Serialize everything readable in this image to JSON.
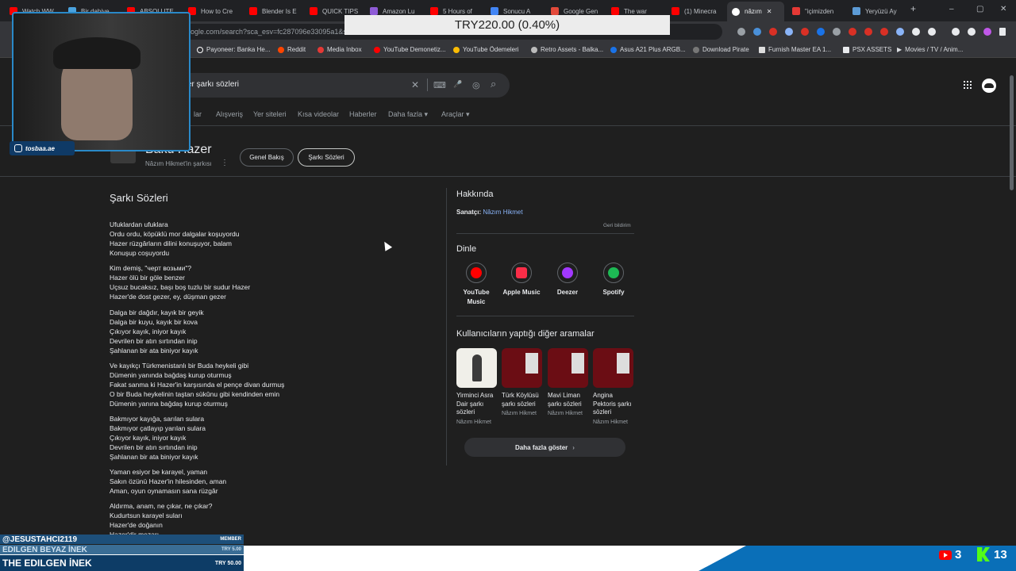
{
  "browser": {
    "tabs": [
      "Watch WW",
      "Bir dahiye",
      "ABSOLUTE",
      "How to Cre",
      "Blender Is E",
      "QUICK TIPS",
      "Amazon Lu",
      "5 Hours of",
      "Sonucu A",
      "Google Gen",
      "The war",
      "(1) Minecra",
      "nâzım",
      "\"içimizden",
      "Yeryüzü Ay"
    ],
    "new_tab": "+",
    "minimize": "–",
    "maximize": "▢",
    "close": "✕",
    "url": "ogle.com/search?sca_esv=fc287096e33095a1&s"
  },
  "bookmarks": [
    "Payoneer: Banka He...",
    "Reddit",
    "Media Inbox",
    "YouTube Demonetiz...",
    "YouTube Ödemeleri",
    "Retro Assets - Balka...",
    "Asus A21 Plus ARGB...",
    "Download Pirate",
    "Furnish Master EA 1...",
    "PSX ASSETS",
    "Movies / TV / Anim..."
  ],
  "search": {
    "query": "er şarkı sözleri",
    "clear_icon": "✕",
    "keyboard_icon": "⌨",
    "mic_icon": "🎤",
    "lens_icon": "◎",
    "search_icon": "⌕"
  },
  "nav_tabs": [
    "lar",
    "Alışveriş",
    "Yer siteleri",
    "Kısa videolar",
    "Haberler",
    "Daha fazla ▾",
    "Araçlar ▾"
  ],
  "entity": {
    "title": "Bakü Hazer",
    "subtitle": "Nâzım Hikmet'in şarkısı",
    "chips": [
      "Genel Bakış",
      "Şarkı Sözleri"
    ]
  },
  "lyrics": {
    "heading": "Şarkı Sözleri",
    "stanzas": [
      [
        "Ufuklardan ufuklara",
        "Ordu ordu, köpüklü mor dalgalar koşuyordu",
        "Hazer rüzgârların dilini konuşuyor, balam",
        "Konuşup coşuyordu"
      ],
      [
        "Kim demiş, \"черт возьми\"?",
        "Hazer ölü bir göle benzer",
        "Uçsuz bucaksız, başı boş tuzlu bir sudur Hazer",
        "Hazer'de dost gezer, ey, düşman gezer"
      ],
      [
        "Dalga bir dağdır, kayık bir geyik",
        "Dalga bir kuyu, kayık bir kova",
        "Çıkıyor kayık, iniyor kayık",
        "Devrilen bir atın sırtından inip",
        "Şahlanan bir ata biniyor kayık"
      ],
      [
        "Ve kayıkçı Türkmenistanlı bir Buda heykeli gibi",
        "Dümenin yanında bağdaş kurup oturmuş",
        "Fakat sanma ki Hazer'in karşısında el pençe divan durmuş",
        "O bir Buda heykelinin taştan sükûnu gibi kendinden emin",
        "Dümenin yanına bağdaş kurup oturmuş"
      ],
      [
        "Bakmıyor kayığa, sarılan sulara",
        "Bakmıyor çatlayıp yarılan sulara",
        "Çıkıyor kayık, iniyor kayık",
        "Devrilen bir atın sırtından inip",
        "Şahlanan bir ata biniyor kayık"
      ],
      [
        "Yaman esiyor be karayel, yaman",
        "Sakın özünü Hazer'in hilesinden, aman",
        "Aman, oyun oynamasın sana rüzgâr"
      ],
      [
        "Aldırma, anam, ne çıkar, ne çıkar?",
        "Kudurtsun karayel suları",
        "Hazer'de doğanın",
        "Hazer'dir mezarı"
      ]
    ]
  },
  "about": {
    "heading": "Hakkında",
    "artist_label": "Sanatçı:",
    "artist": "Nâzım Hikmet",
    "feedback": "Geri bildirim"
  },
  "listen": {
    "heading": "Dinle",
    "services": [
      {
        "name": "YouTube Music",
        "color": "#ff0000"
      },
      {
        "name": "Apple Music",
        "color": "#fa2d48"
      },
      {
        "name": "Deezer",
        "color": "#a238ff"
      },
      {
        "name": "Spotify",
        "color": "#1db954"
      }
    ]
  },
  "related": {
    "heading": "Kullanıcıların yaptığı diğer aramalar",
    "cards": [
      {
        "name": "Yirminci Asra Dair şarkı sözleri",
        "sub": "Nâzım Hikmet"
      },
      {
        "name": "Türk Köylüsü şarkı sözleri",
        "sub": "Nâzım Hikmet"
      },
      {
        "name": "Mavi Liman şarkı sözleri",
        "sub": "Nâzım Hikmet"
      },
      {
        "name": "Angina Pektoris şarkı sözleri",
        "sub": "Nâzım Hikmet"
      }
    ],
    "more_button": "Daha fazla göster"
  },
  "overlay": {
    "donation": "TRY220.00 (0.40%)",
    "instagram": "tosbaa.ae",
    "ticker": [
      {
        "user": "@JESUSTAHCI2119",
        "right": "MEMBER"
      },
      {
        "user": "EDILGEN BEYAZ İNEK",
        "right": "TRY 5.00"
      },
      {
        "user": "THE EDILGEN İNEK",
        "right": "TRY 50.00"
      }
    ],
    "youtube_count": "3",
    "kick_count": "13"
  }
}
